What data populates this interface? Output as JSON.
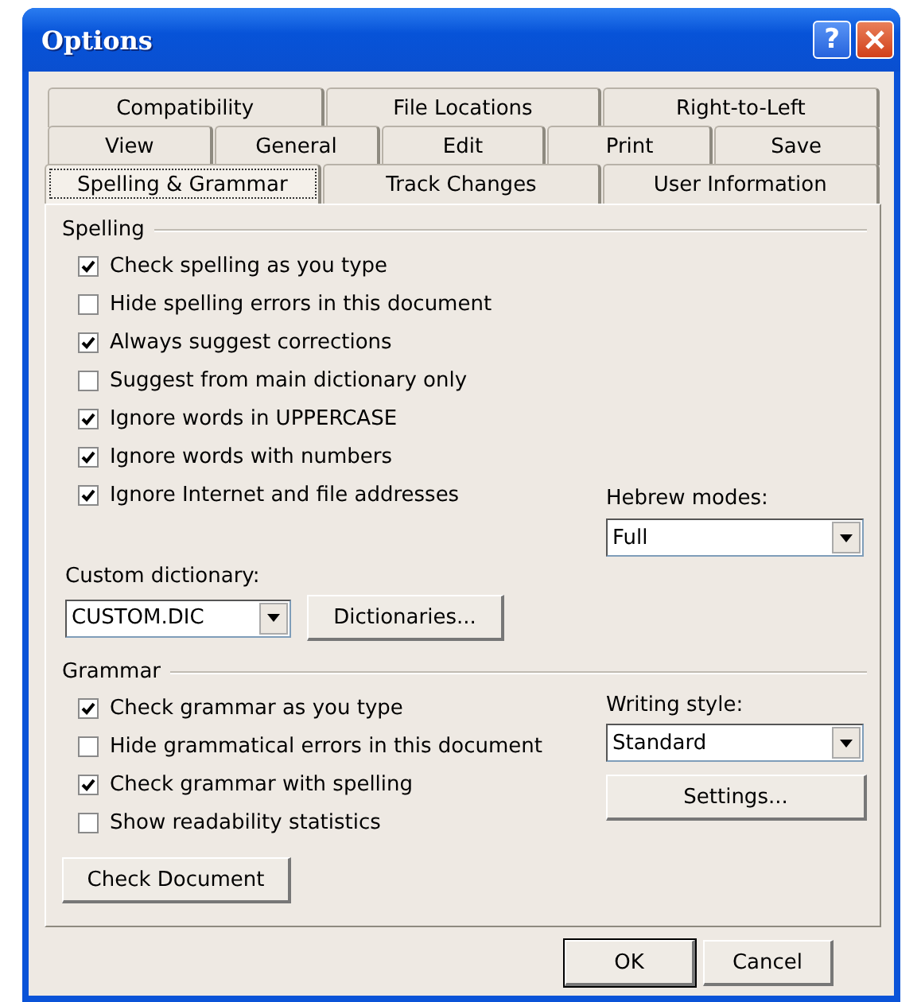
{
  "window": {
    "title": "Options",
    "help": "?"
  },
  "tab_rows": [
    [
      {
        "label": "Compatibility",
        "selected": false
      },
      {
        "label": "File Locations",
        "selected": false
      },
      {
        "label": "Right-to-Left",
        "selected": false
      }
    ],
    [
      {
        "label": "View",
        "selected": false
      },
      {
        "label": "General",
        "selected": false
      },
      {
        "label": "Edit",
        "selected": false
      },
      {
        "label": "Print",
        "selected": false
      },
      {
        "label": "Save",
        "selected": false
      }
    ],
    [
      {
        "label": "Spelling & Grammar",
        "selected": true
      },
      {
        "label": "Track Changes",
        "selected": false
      },
      {
        "label": "User Information",
        "selected": false
      }
    ]
  ],
  "spelling": {
    "heading": "Spelling",
    "options": [
      {
        "label": "Check spelling as you type",
        "checked": true
      },
      {
        "label": "Hide spelling errors in this document",
        "checked": false
      },
      {
        "label": "Always suggest corrections",
        "checked": true
      },
      {
        "label": "Suggest from main dictionary only",
        "checked": false
      },
      {
        "label": "Ignore words in UPPERCASE",
        "checked": true
      },
      {
        "label": "Ignore words with numbers",
        "checked": true
      },
      {
        "label": "Ignore Internet and file addresses",
        "checked": true
      }
    ],
    "hebrew_modes": {
      "label": "Hebrew modes:",
      "value": "Full"
    },
    "custom_dictionary": {
      "label": "Custom dictionary:",
      "value": "CUSTOM.DIC"
    },
    "dictionaries_button": "Dictionaries..."
  },
  "grammar": {
    "heading": "Grammar",
    "options": [
      {
        "label": "Check grammar as you type",
        "checked": true
      },
      {
        "label": "Hide grammatical errors in this document",
        "checked": false
      },
      {
        "label": "Check grammar with spelling",
        "checked": true
      },
      {
        "label": "Show readability statistics",
        "checked": false
      }
    ],
    "writing_style": {
      "label": "Writing style:",
      "value": "Standard"
    },
    "settings_button": "Settings...",
    "check_document_button": "Check Document"
  },
  "buttons": [
    {
      "label": "OK",
      "default": true
    },
    {
      "label": "Cancel",
      "default": false
    }
  ]
}
